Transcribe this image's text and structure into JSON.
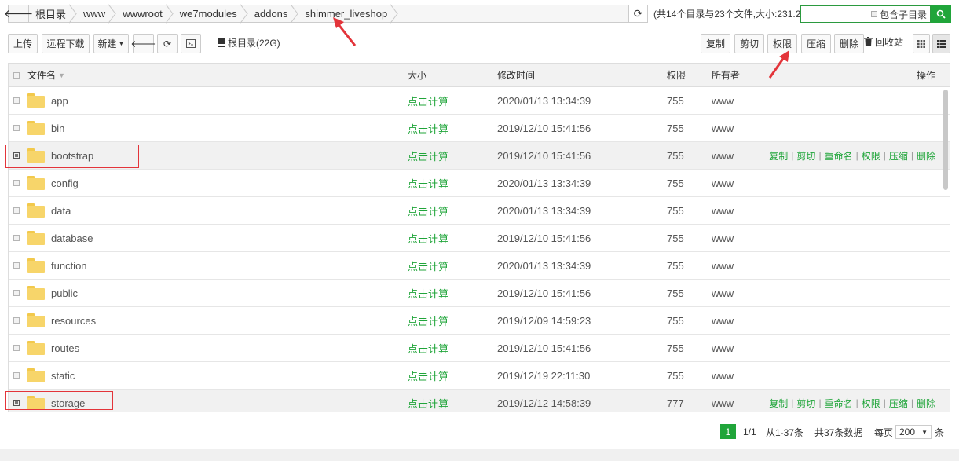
{
  "breadcrumb": {
    "items": [
      "根目录",
      "www",
      "wwwroot",
      "we7modules",
      "addons",
      "shimmer_liveshop"
    ]
  },
  "summary": "(共14个目录与23个文件,大小:231.2",
  "search": {
    "include_subdir_label": "包含子目录"
  },
  "toolbar": {
    "upload": "上传",
    "remote_download": "远程下载",
    "new": "新建",
    "disk": "根目录(22G)",
    "copy": "复制",
    "cut": "剪切",
    "permission": "权限",
    "compress": "压缩",
    "delete": "删除",
    "recycle_bin": "回收站"
  },
  "table": {
    "headers": {
      "name": "文件名",
      "size": "大小",
      "mtime": "修改时间",
      "perm": "权限",
      "owner": "所有者",
      "ops": "操作"
    },
    "rows": [
      {
        "name": "app",
        "size": "点击计算",
        "mtime": "2020/01/13 13:34:39",
        "perm": "755",
        "owner": "www",
        "selected": false
      },
      {
        "name": "bin",
        "size": "点击计算",
        "mtime": "2019/12/10 15:41:56",
        "perm": "755",
        "owner": "www",
        "selected": false
      },
      {
        "name": "bootstrap",
        "size": "点击计算",
        "mtime": "2019/12/10 15:41:56",
        "perm": "755",
        "owner": "www",
        "selected": true
      },
      {
        "name": "config",
        "size": "点击计算",
        "mtime": "2020/01/13 13:34:39",
        "perm": "755",
        "owner": "www",
        "selected": false
      },
      {
        "name": "data",
        "size": "点击计算",
        "mtime": "2020/01/13 13:34:39",
        "perm": "755",
        "owner": "www",
        "selected": false
      },
      {
        "name": "database",
        "size": "点击计算",
        "mtime": "2019/12/10 15:41:56",
        "perm": "755",
        "owner": "www",
        "selected": false
      },
      {
        "name": "function",
        "size": "点击计算",
        "mtime": "2020/01/13 13:34:39",
        "perm": "755",
        "owner": "www",
        "selected": false
      },
      {
        "name": "public",
        "size": "点击计算",
        "mtime": "2019/12/10 15:41:56",
        "perm": "755",
        "owner": "www",
        "selected": false
      },
      {
        "name": "resources",
        "size": "点击计算",
        "mtime": "2019/12/09 14:59:23",
        "perm": "755",
        "owner": "www",
        "selected": false
      },
      {
        "name": "routes",
        "size": "点击计算",
        "mtime": "2019/12/10 15:41:56",
        "perm": "755",
        "owner": "www",
        "selected": false
      },
      {
        "name": "static",
        "size": "点击计算",
        "mtime": "2019/12/19 22:11:30",
        "perm": "755",
        "owner": "www",
        "selected": false
      },
      {
        "name": "storage",
        "size": "点击计算",
        "mtime": "2019/12/12 14:58:39",
        "perm": "777",
        "owner": "www",
        "selected": true
      }
    ],
    "row_ops": [
      "复制",
      "剪切",
      "重命名",
      "权限",
      "压缩",
      "删除"
    ]
  },
  "pagination": {
    "current": "1",
    "page_of": "1/1",
    "range": "从1-37条",
    "total": "共37条数据",
    "per_page_label": "每页",
    "per_page": "200",
    "unit": "条"
  }
}
